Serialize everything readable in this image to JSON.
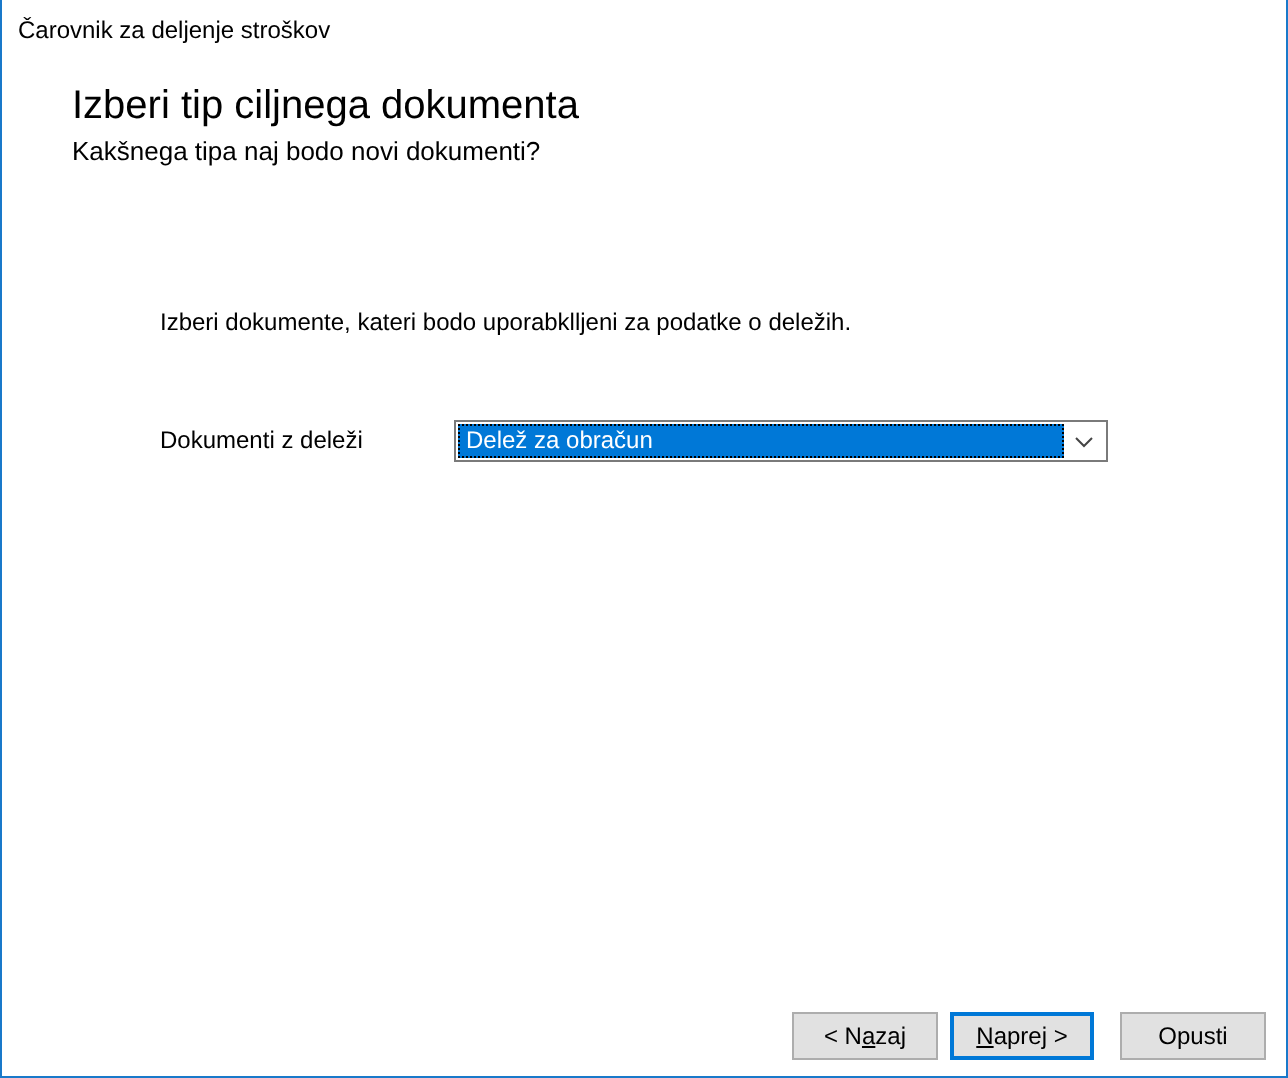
{
  "window": {
    "title": "Čarovnik za deljenje stroškov"
  },
  "header": {
    "title": "Izberi tip ciljnega dokumenta",
    "subtitle": "Kakšnega tipa naj bodo novi dokumenti?"
  },
  "instruction": "Izberi dokumente, kateri bodo uporabklljeni za podatke o deležih.",
  "field": {
    "label": "Dokumenti z deleži",
    "value": "Delež za obračun",
    "focused": true
  },
  "buttons": [
    {
      "before": "< N",
      "mnemonic": "a",
      "after": "zaj",
      "default": false
    },
    {
      "mnemonic": "N",
      "after": "aprej >",
      "default": true
    },
    {
      "before": "Opusti",
      "default": false
    }
  ]
}
